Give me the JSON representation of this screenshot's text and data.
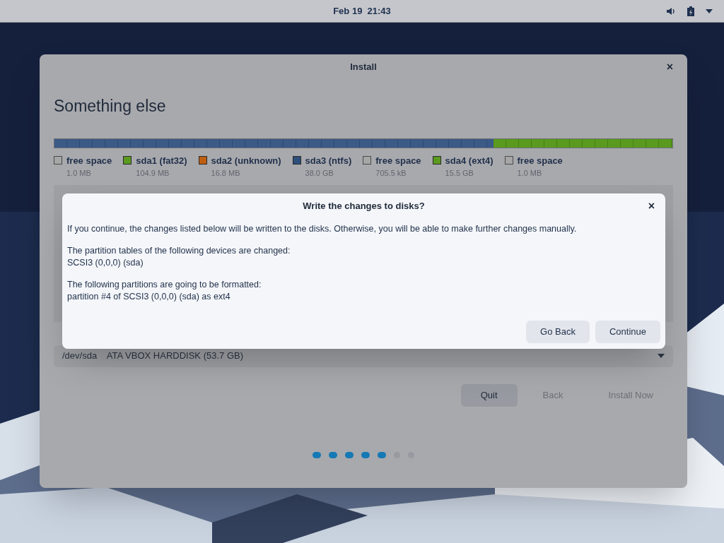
{
  "top_bar": {
    "clock": "Feb 19  21:43"
  },
  "window": {
    "title": "Install",
    "close": "×",
    "heading": "Something else",
    "bar_segments": [
      {
        "color": "#3b5a86",
        "level": 0.71
      },
      {
        "color": "#5a9a1e",
        "level": 0.29
      }
    ],
    "legend": [
      {
        "name": "free space",
        "size": "1.0 MB",
        "color": "#a6a6a6",
        "kind": "empty"
      },
      {
        "name": "sda1 (fat32)",
        "size": "104.9 MB",
        "color": "#5a9a1e",
        "kind": "filled"
      },
      {
        "name": "sda2 (unknown)",
        "size": "16.8 MB",
        "color": "#c05e10",
        "kind": "filled"
      },
      {
        "name": "sda3 (ntfs)",
        "size": "38.0 GB",
        "color": "#2d4f7c",
        "kind": "filled"
      },
      {
        "name": "free space",
        "size": "705.5 kB",
        "color": "#a6a6a6",
        "kind": "empty"
      },
      {
        "name": "sda4 (ext4)",
        "size": "15.5 GB",
        "color": "#5a9a1e",
        "kind": "filled"
      },
      {
        "name": "free space",
        "size": "1.0 MB",
        "color": "#a6a6a6",
        "kind": "empty"
      }
    ],
    "device_select": {
      "value": "/dev/sda    ATA VBOX HARDDISK (53.7 GB)"
    },
    "buttons": [
      {
        "label": "Quit",
        "disabled": false
      },
      {
        "label": "Back",
        "disabled": true
      },
      {
        "label": "Install Now",
        "disabled": true
      }
    ],
    "steps": [
      {
        "done": true
      },
      {
        "done": true
      },
      {
        "done": true
      },
      {
        "done": true
      },
      {
        "done": true
      },
      {
        "done": false
      },
      {
        "done": false
      }
    ]
  },
  "dialog": {
    "title": "Write the changes to disks?",
    "close": "×",
    "paragraphs": [
      "If you continue, the changes listed below will be written to the disks. Otherwise, you will be able to make further changes manually.",
      "The partition tables of the following devices are changed:\n SCSI3 (0,0,0) (sda)",
      "The following partitions are going to be formatted:\n partition #4 of SCSI3 (0,0,0) (sda) as ext4"
    ],
    "buttons": [
      "Go Back",
      "Continue"
    ]
  }
}
